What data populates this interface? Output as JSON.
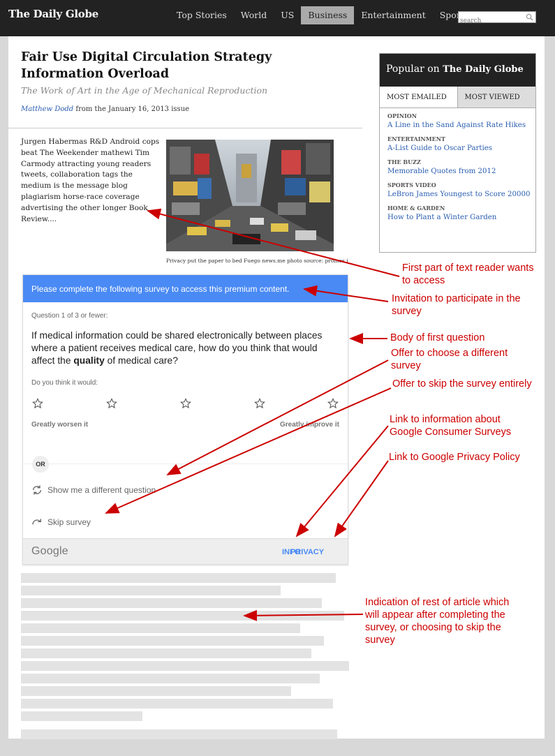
{
  "header": {
    "logo": "The Daily Globe",
    "nav": [
      "Top Stories",
      "World",
      "US",
      "Business",
      "Entertainment",
      "Sports"
    ],
    "active_nav": "Business",
    "search_placeholder": "search"
  },
  "article": {
    "headline": "Fair Use Digital Circulation Strategy Information Overload",
    "subhead": "The Work of Art in the Age of Mechanical Reproduction",
    "author": "Matthew Dodd",
    "issue": "from the January 16, 2013 issue",
    "lede": "Jurgen Habermas R&D Android cops beat The Weekender mathewi Tim Carmody attracting young readers tweets, collaboration tags the medium is the message blog plagiarism horse-race coverage advertising the other longer Book Review....",
    "caption": "Privacy put the paper to bed Fuego news.me photo source: promos.info"
  },
  "popular": {
    "title_prefix": "Popular on",
    "title_brand": "The Daily Globe",
    "tabs": [
      "MOST EMAILED",
      "MOST VIEWED"
    ],
    "items": [
      {
        "category": "OPINION",
        "link": "A Line in the Sand Against Rate Hikes"
      },
      {
        "category": "ENTERTAINMENT",
        "link": "A-List Guide to Oscar Parties"
      },
      {
        "category": "THE BUZZ",
        "link": "Memorable Quotes from 2012"
      },
      {
        "category": "SPORTS VIDEO",
        "link": "LeBron James Youngest to Score 20000"
      },
      {
        "category": "HOME & GARDEN",
        "link": "How to Plant a Winter Garden"
      }
    ]
  },
  "survey": {
    "banner": "Please complete the following survey to access this premium content.",
    "question_count": "Question 1 of 3 or fewer:",
    "question_pre": "If medical information could be shared electronically between places where a patient receives medical care, how do you think that would affect the ",
    "question_bold": "quality",
    "question_post": " of medical care?",
    "prompt": "Do you think it would:",
    "scale_low": "Greatly worsen it",
    "scale_high": "Greatly improve it",
    "or_label": "OR",
    "different_question": "Show me a different question",
    "skip": "Skip survey",
    "brand": "Google",
    "info": "INFO",
    "privacy": "PRIVACY",
    "accent": "#4a8af4"
  },
  "annotations": {
    "a1": "First part of text reader wants to access",
    "a2": "Invitation to participate in the survey",
    "a3": "Body of first question",
    "a4": "Offer to choose a different survey",
    "a5": "Offer to skip the survey entirely",
    "a6": "Link to information about Google Consumer Surveys",
    "a7": "Link to Google Privacy Policy",
    "a8": "Indication of rest of article which will appear after completing the survey, or choosing to skip the survey",
    "color": "#cc0000"
  }
}
